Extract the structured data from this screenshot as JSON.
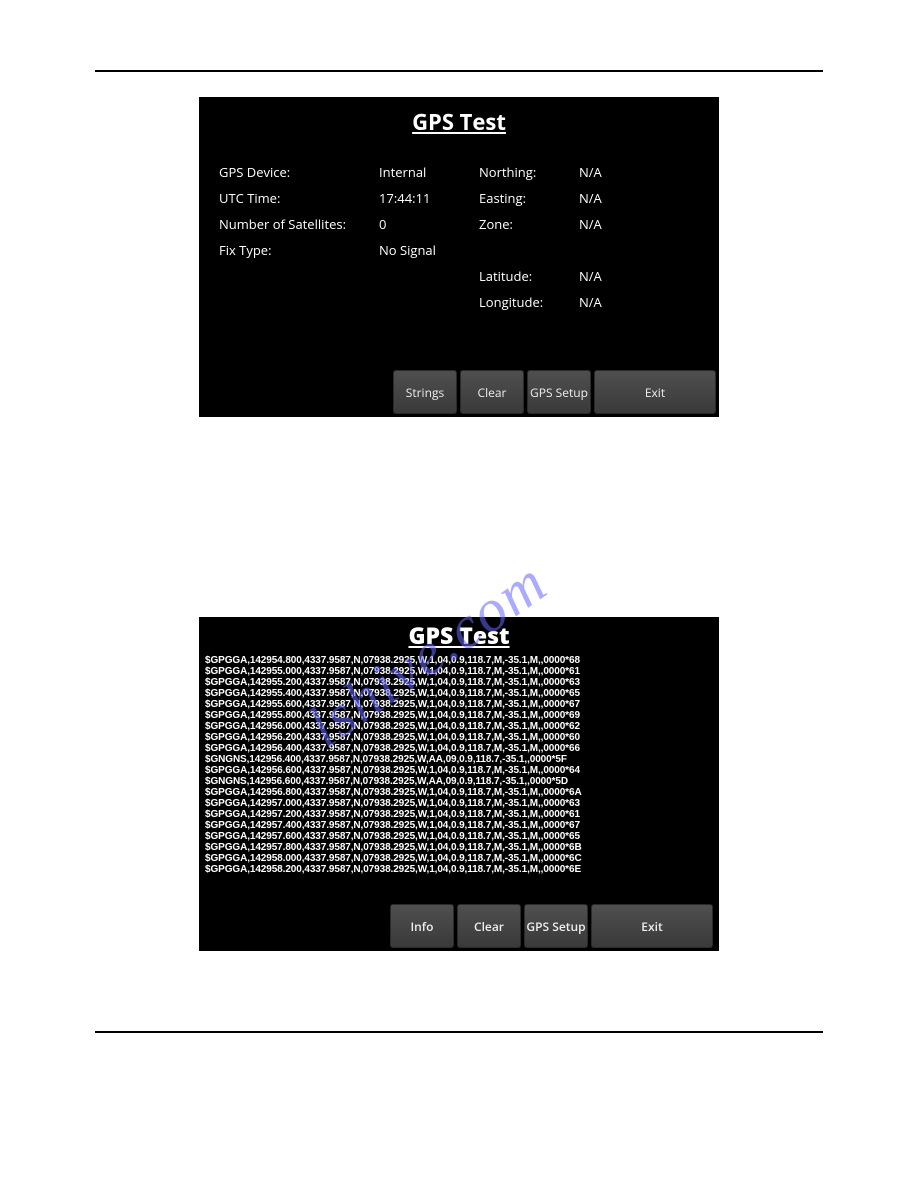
{
  "panel1": {
    "title": "GPS Test",
    "left": {
      "device_label": "GPS Device:",
      "device_value": "Internal",
      "utc_label": "UTC Time:",
      "utc_value": "17:44:11",
      "sats_label": "Number of Satellites:",
      "sats_value": "0",
      "fix_label": "Fix Type:",
      "fix_value": "No Signal"
    },
    "right": {
      "northing_label": "Northing:",
      "northing_value": "N/A",
      "easting_label": "Easting:",
      "easting_value": "N/A",
      "zone_label": "Zone:",
      "zone_value": "N/A",
      "lat_label": "Latitude:",
      "lat_value": "N/A",
      "lon_label": "Longitude:",
      "lon_value": "N/A"
    },
    "buttons": {
      "strings": "Strings",
      "clear": "Clear",
      "gps_setup": "GPS Setup",
      "exit": "Exit"
    }
  },
  "panel2": {
    "title": "GPS Test",
    "lines": [
      "$GPGGA,142954.800,4337.9587,N,07938.2925,W,1,04,0.9,118.7,M,-35.1,M,,0000*68",
      "$GPGGA,142955.000,4337.9587,N,07938.2925,W,1,04,0.9,118.7,M,-35.1,M,,0000*61",
      "$GPGGA,142955.200,4337.9587,N,07938.2925,W,1,04,0.9,118.7,M,-35.1,M,,0000*63",
      "$GPGGA,142955.400,4337.9587,N,07938.2925,W,1,04,0.9,118.7,M,-35.1,M,,0000*65",
      "$GPGGA,142955.600,4337.9587,N,07938.2925,W,1,04,0.9,118.7,M,-35.1,M,,0000*67",
      "$GPGGA,142955.800,4337.9587,N,07938.2925,W,1,04,0.9,118.7,M,-35.1,M,,0000*69",
      "$GPGGA,142956.000,4337.9587,N,07938.2925,W,1,04,0.9,118.7,M,-35.1,M,,0000*62",
      "$GPGGA,142956.200,4337.9587,N,07938.2925,W,1,04,0.9,118.7,M,-35.1,M,,0000*60",
      "$GPGGA,142956.400,4337.9587,N,07938.2925,W,1,04,0.9,118.7,M,-35.1,M,,0000*66",
      "$GNGNS,142956.400,4337.9587,N,07938.2925,W,AA,09,0.9,118.7,-35.1,,0000*5F",
      "$GPGGA,142956.600,4337.9587,N,07938.2925,W,1,04,0.9,118.7,M,-35.1,M,,0000*64",
      "$GNGNS,142956.600,4337.9587,N,07938.2925,W,AA,09,0.9,118.7,-35.1,,0000*5D",
      "$GPGGA,142956.800,4337.9587,N,07938.2925,W,1,04,0.9,118.7,M,-35.1,M,,0000*6A",
      "$GPGGA,142957.000,4337.9587,N,07938.2925,W,1,04,0.9,118.7,M,-35.1,M,,0000*63",
      "$GPGGA,142957.200,4337.9587,N,07938.2925,W,1,04,0.9,118.7,M,-35.1,M,,0000*61",
      "$GPGGA,142957.400,4337.9587,N,07938.2925,W,1,04,0.9,118.7,M,-35.1,M,,0000*67",
      "$GPGGA,142957.600,4337.9587,N,07938.2925,W,1,04,0.9,118.7,M,-35.1,M,,0000*65",
      "$GPGGA,142957.800,4337.9587,N,07938.2925,W,1,04,0.9,118.7,M,-35.1,M,,0000*6B",
      "$GPGGA,142958.000,4337.9587,N,07938.2925,W,1,04,0.9,118.7,M,-35.1,M,,0000*6C",
      "$GPGGA,142958.200,4337.9587,N,07938.2925,W,1,04,0.9,118.7,M,-35.1,M,,0000*6E"
    ],
    "buttons": {
      "info": "Info",
      "clear": "Clear",
      "gps_setup": "GPS Setup",
      "exit": "Exit"
    }
  },
  "watermark_text": "lshive.com"
}
